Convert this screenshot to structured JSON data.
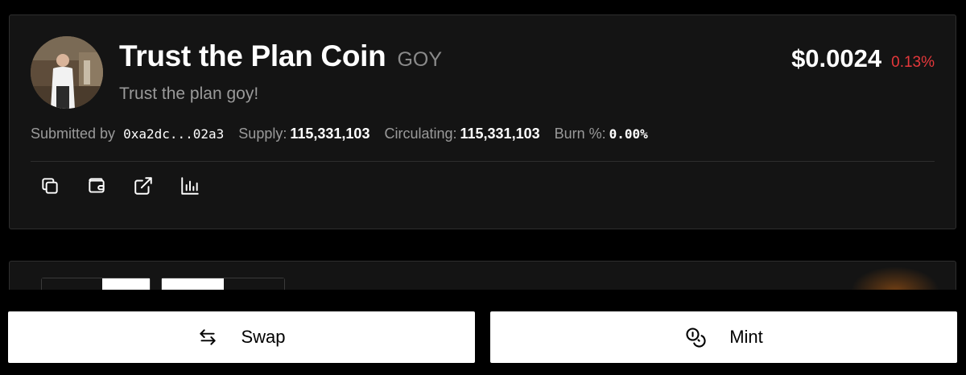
{
  "coin": {
    "name": "Trust the Plan Coin",
    "ticker": "GOY",
    "description": "Trust the plan goy!",
    "price": "$0.0024",
    "change": "0.13%"
  },
  "stats": {
    "submitted_label": "Submitted by",
    "submitted_value": "0xa2dc...02a3",
    "supply_label": "Supply:",
    "supply_value": "115,331,103",
    "circulating_label": "Circulating:",
    "circulating_value": "115,331,103",
    "burn_label": "Burn %:",
    "burn_value": "0.00%"
  },
  "actions": [
    {
      "icon": "copy-icon"
    },
    {
      "icon": "wallet-icon"
    },
    {
      "icon": "external-link-icon"
    },
    {
      "icon": "chart-icon"
    }
  ],
  "buttons": {
    "swap_label": "Swap",
    "mint_label": "Mint"
  },
  "colors": {
    "background": "#000000",
    "card": "#141414",
    "negative": "#e5383b",
    "button": "#ffffff"
  }
}
